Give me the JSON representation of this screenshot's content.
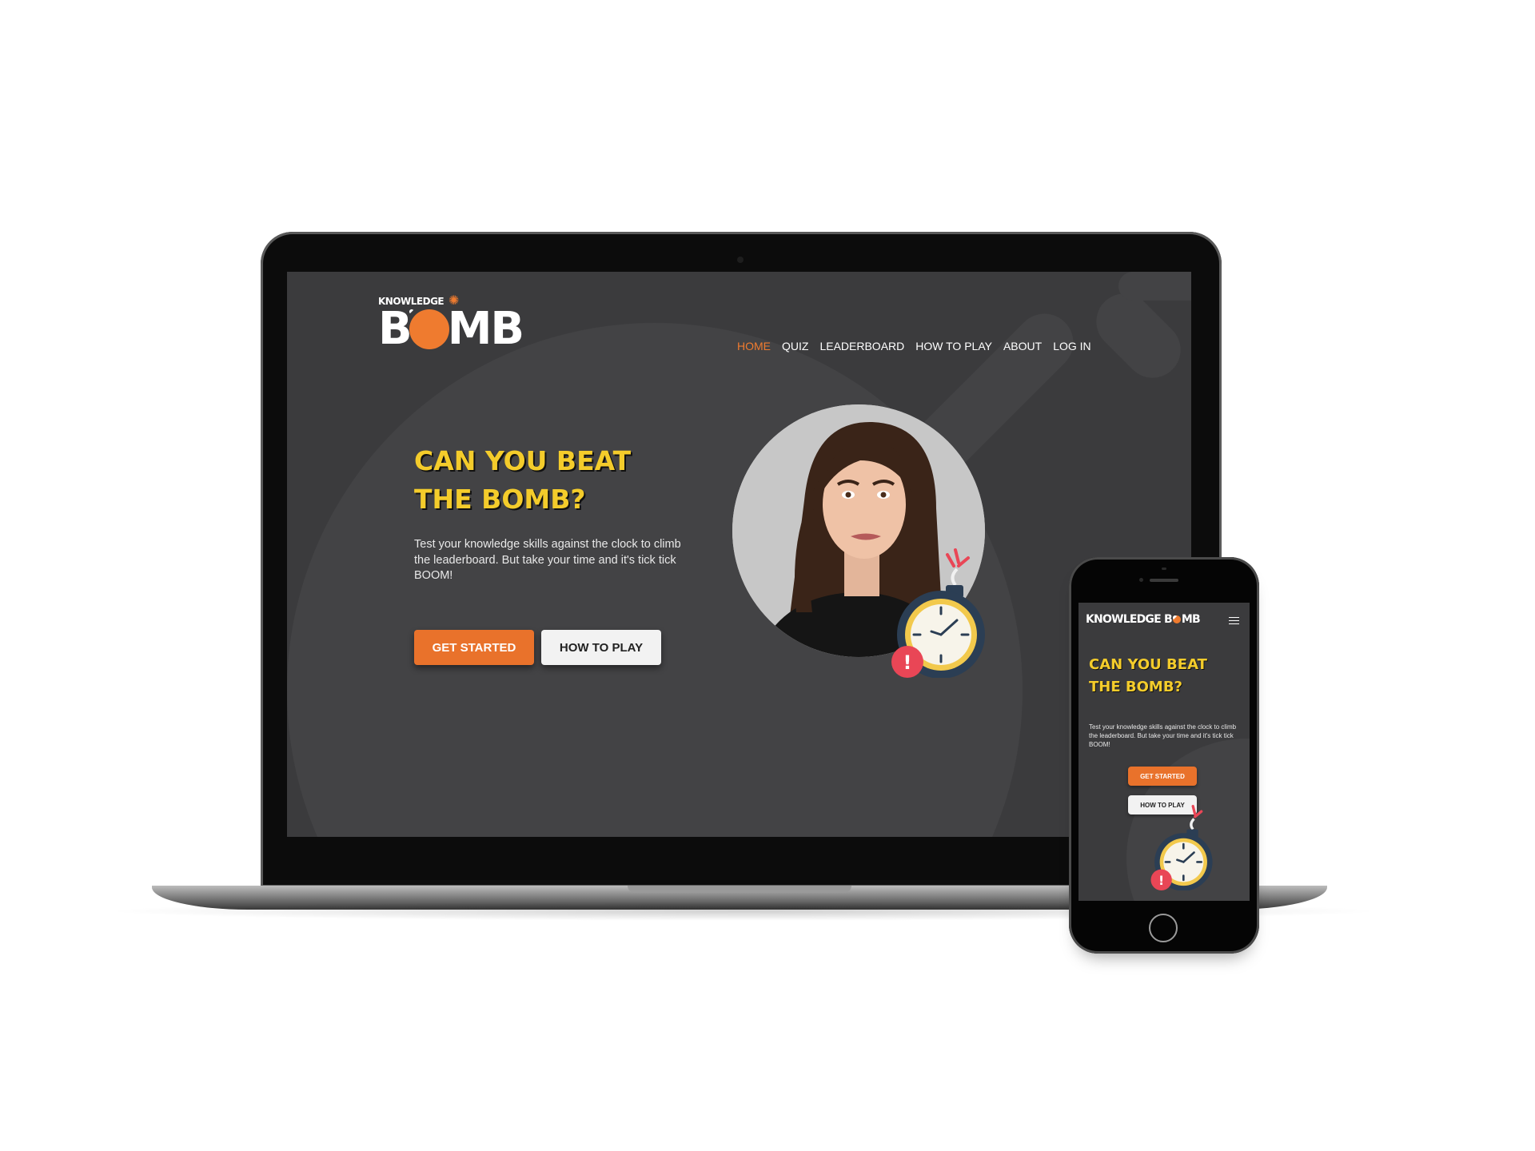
{
  "brand": {
    "logo_small": "KNOWLEDGE",
    "logo_big_pre": "B",
    "logo_big_post": "MB",
    "mobile_logo_pre": "KNOWLEDGE B",
    "mobile_logo_post": "MB",
    "accent_color": "#ef7b2f",
    "title_color": "#f4cc2b",
    "screen_bg": "#3b3b3d"
  },
  "nav": {
    "items": [
      {
        "label": "HOME",
        "active": true
      },
      {
        "label": "QUIZ"
      },
      {
        "label": "LEADERBOARD"
      },
      {
        "label": "HOW TO PLAY"
      },
      {
        "label": "ABOUT"
      },
      {
        "label": "LOG IN"
      }
    ],
    "menu_icon": "hamburger-icon"
  },
  "hero": {
    "title_line1": "CAN YOU BEAT",
    "title_line2": "THE BOMB?",
    "body": "Test your knowledge skills against the clock to climb the leaderboard. But take your time and it's tick tick BOOM!",
    "primary_button": "GET STARTED",
    "secondary_button": "HOW TO PLAY",
    "portrait_alt": "worried-woman-portrait",
    "illustration": "stopwatch-bomb-icon",
    "alert_icon": "exclamation-alert-icon"
  }
}
